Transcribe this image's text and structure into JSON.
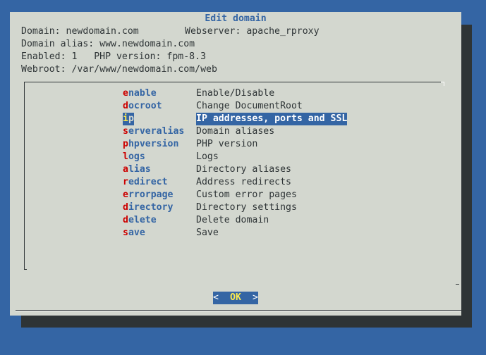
{
  "dialog": {
    "title": "Edit domain",
    "info": {
      "domain_line": "Domain: newdomain.com",
      "webserver_line": "Webserver: apache_rproxy",
      "alias_line": "Domain alias: www.newdomain.com",
      "enabled_line": "Enabled: 1   PHP version: fpm-8.3",
      "webroot_line": "Webroot: /var/www/newdomain.com/web"
    },
    "menu": [
      {
        "hot": "e",
        "rest": "nable",
        "desc": "Enable/Disable",
        "selected": false
      },
      {
        "hot": "d",
        "rest": "ocroot",
        "desc": "Change DocumentRoot",
        "selected": false
      },
      {
        "hot": "i",
        "rest": "p",
        "desc": "IP addresses, ports and SSL",
        "selected": true
      },
      {
        "hot": "s",
        "rest": "erveralias",
        "desc": "Domain aliases",
        "selected": false
      },
      {
        "hot": "p",
        "rest": "hpversion",
        "desc": "PHP version",
        "selected": false
      },
      {
        "hot": "l",
        "rest": "ogs",
        "desc": "Logs",
        "selected": false
      },
      {
        "hot": "a",
        "rest": "lias",
        "desc": "Directory aliases",
        "selected": false
      },
      {
        "hot": "r",
        "rest": "edirect",
        "desc": "Address redirects",
        "selected": false
      },
      {
        "hot": "e",
        "rest": "rrorpage",
        "desc": "Custom error pages",
        "selected": false
      },
      {
        "hot": "d",
        "rest": "irectory",
        "desc": "Directory settings",
        "selected": false
      },
      {
        "hot": "d",
        "rest": "elete",
        "desc": "Delete domain",
        "selected": false
      },
      {
        "hot": "s",
        "rest": "ave",
        "desc": "Save",
        "selected": false
      }
    ],
    "ok_button": {
      "left_bracket": "<",
      "label": "OK",
      "right_bracket": ">"
    }
  },
  "colors": {
    "desktop": "#3465a4",
    "dialog": "#d3d7cf",
    "shadow": "#2e3436",
    "highlight": "#3465a4",
    "hotkey": "#cc0000",
    "hotkey_selected": "#fce94f"
  }
}
